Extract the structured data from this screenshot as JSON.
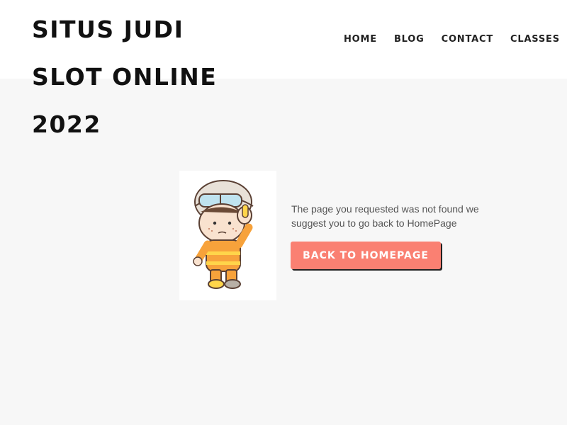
{
  "site": {
    "title": "SITUS JUDI SLOT ONLINE 2022"
  },
  "nav": {
    "items": [
      {
        "label": "HOME"
      },
      {
        "label": "BLOG"
      },
      {
        "label": "CONTACT"
      },
      {
        "label": "CLASSES"
      }
    ]
  },
  "error": {
    "illustration": "firefighter-mascot-icon",
    "message": "The page you requested was not found we suggest you to go back to HomePage",
    "button_label": "BACK TO HOMEPAGE"
  },
  "colors": {
    "accent": "#fa8072",
    "background": "#f7f7f7",
    "header": "#ffffff",
    "text": "#555555"
  }
}
